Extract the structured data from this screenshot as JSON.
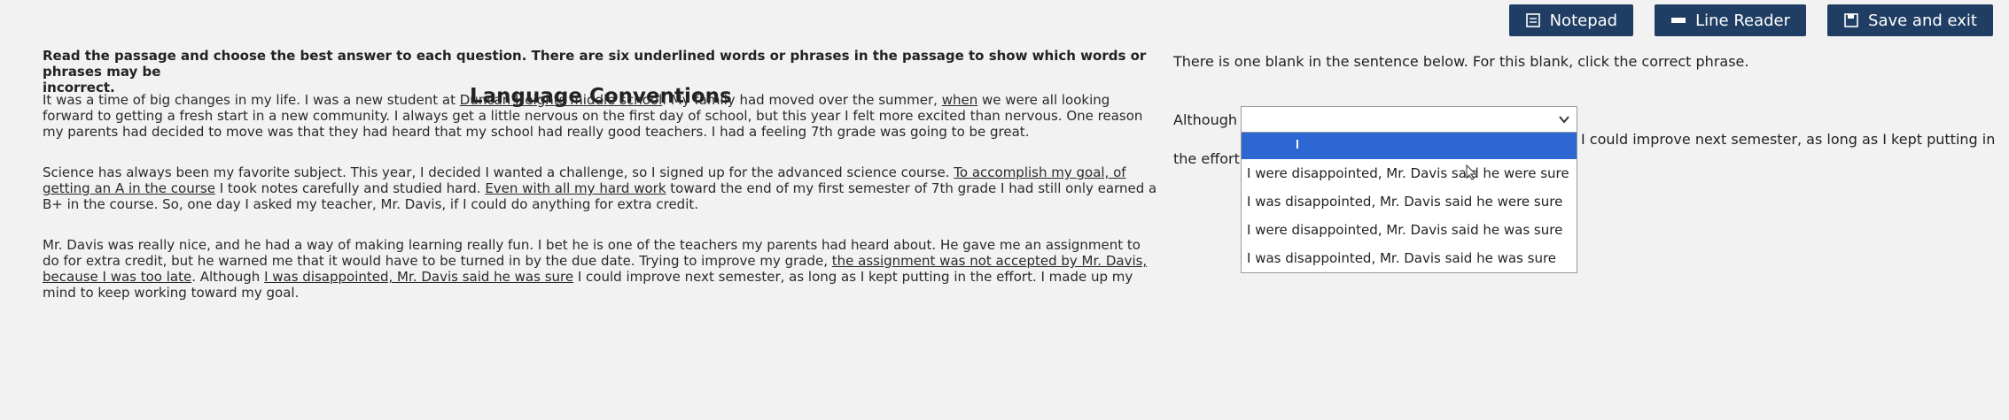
{
  "toolbar": {
    "notepad_label": "Notepad",
    "line_reader_label": "Line Reader",
    "save_exit_label": "Save and exit",
    "notepad_icon": "notepad-icon",
    "line_reader_icon": "line-reader-icon",
    "save_icon": "save-icon",
    "accent": "#203e63"
  },
  "instructions": {
    "text_line1": "Read the passage and choose the best answer to each question. There are six underlined words or phrases in the passage to show which words or phrases may be",
    "text_line2": "incorrect."
  },
  "passage": {
    "title": "Language Conventions",
    "p1": {
      "a": "It was a time of big changes in my life. I was a new student at ",
      "u1": "Duncan Heights middle school",
      "b": ". My family had moved over the summer, ",
      "u2": "when",
      "c": " we were all looking forward to getting a fresh start in a new community. I always get a little nervous on the first day of school, but this year I felt more excited than nervous. One reason my parents had decided to move was that they had heard that my school had really good teachers. I had a feeling 7th grade was going to be great."
    },
    "p2": {
      "a": "Science has always been my favorite subject. This year, I decided I wanted a challenge, so I signed up for the advanced science course. ",
      "u1": "To accomplish my goal, of getting an A in the course",
      "b": " I took notes carefully and studied hard. ",
      "u2": "Even with all my hard work",
      "c": " toward the end of my first semester of 7th grade I had still only earned a B+ in the course. So, one day I asked my teacher, Mr. Davis, if I could do anything for extra credit."
    },
    "p3": {
      "a": "Mr. Davis was really nice, and he had a way of making learning really fun. I bet he is one of the teachers my parents had heard about. He gave me an assignment to do for extra credit, but he warned me that it would have to be turned in by the due date. Trying to improve my grade, ",
      "u1": "the assignment was not accepted by Mr. Davis, because I was too late",
      "b": ". Although ",
      "u2": "I was disappointed, Mr. Davis said he was sure",
      "c": " I could improve next semester, as long as I kept putting in the effort. I made up my mind to keep working toward my goal."
    }
  },
  "question": {
    "prompt": "There is one blank in the sentence below. For this blank, click the correct phrase.",
    "lead": "Although",
    "lead2": "the effort.",
    "tail": "I could improve next semester, as long as I kept putting in",
    "dropdown": {
      "selected": "",
      "options": [
        "I were disappointed, Mr. Davis said he were sure",
        "I was disappointed, Mr. Davis said he were sure",
        "I were disappointed, Mr. Davis said he was sure",
        "I was disappointed, Mr. Davis said he was sure"
      ],
      "highlight_color": "#2c67d2"
    }
  }
}
